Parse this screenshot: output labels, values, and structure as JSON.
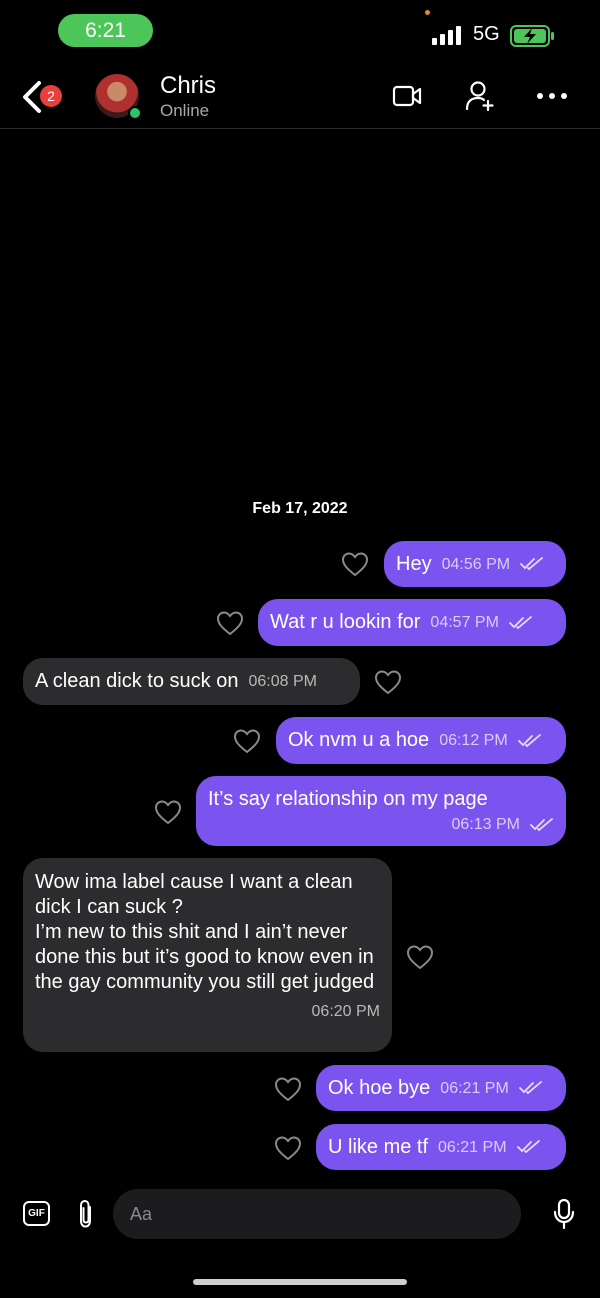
{
  "status_bar": {
    "time": "6:21",
    "network": "5G"
  },
  "header": {
    "back_badge": "2",
    "contact_name": "Chris",
    "contact_status": "Online"
  },
  "chat": {
    "date_separator": "Feb 17, 2022",
    "messages": [
      {
        "dir": "out",
        "text": "Hey",
        "time": "04:56 PM"
      },
      {
        "dir": "out",
        "text": "Wat r u lookin for",
        "time": "04:57 PM"
      },
      {
        "dir": "in",
        "text": "A clean dick to suck on",
        "time": "06:08 PM"
      },
      {
        "dir": "out",
        "text": "Ok nvm u a hoe",
        "time": "06:12 PM"
      },
      {
        "dir": "out",
        "text": "It’s say relationship on my page",
        "time": "06:13 PM"
      },
      {
        "dir": "in",
        "text": "Wow ima label cause I want a clean dick I can suck ?\nI’m new to this shit and I ain’t never done this but it’s good to know even in the gay community you still get judged",
        "time": "06:20 PM"
      },
      {
        "dir": "out",
        "text": "Ok hoe bye",
        "time": "06:21 PM"
      },
      {
        "dir": "out",
        "text": "U like me tf",
        "time": "06:21 PM"
      }
    ]
  },
  "composer": {
    "placeholder": "Aa",
    "gif_label": "GIF"
  },
  "colors": {
    "outgoing": "#7b54f0",
    "incoming": "#2c2c2e",
    "time_pill": "#4cc659",
    "badge": "#e8413c"
  }
}
